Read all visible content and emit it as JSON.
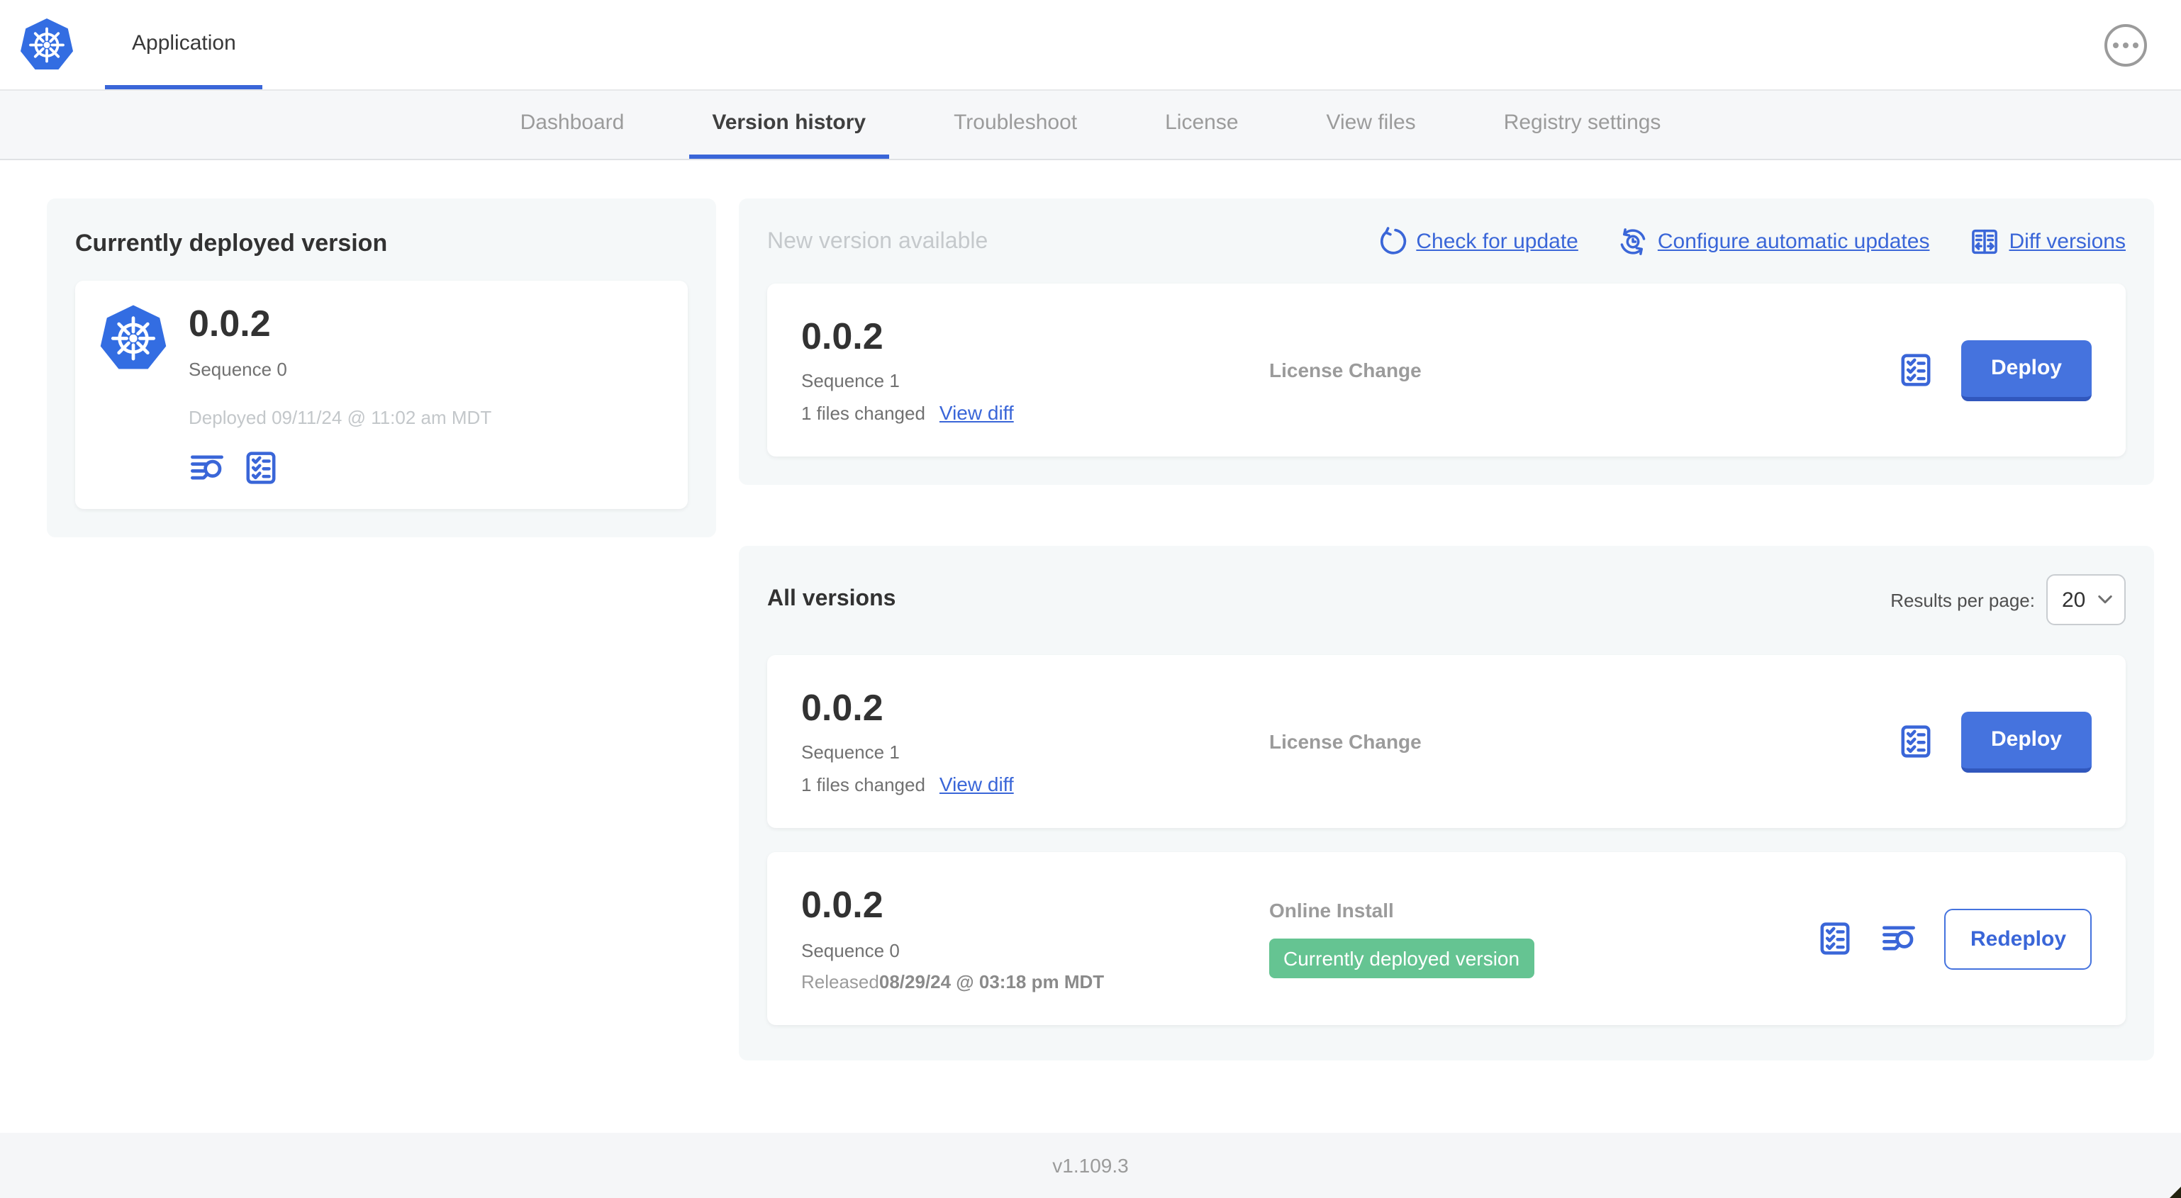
{
  "colors": {
    "accent_blue": "#3a66d8",
    "button_blue": "#4573de",
    "badge_green": "#65c492",
    "k8s_blue": "#336de2",
    "panel_bg": "#f5f8f9"
  },
  "header": {
    "app_tab_label": "Application"
  },
  "nav": {
    "tabs": [
      {
        "label": "Dashboard",
        "active": false
      },
      {
        "label": "Version history",
        "active": true
      },
      {
        "label": "Troubleshoot",
        "active": false
      },
      {
        "label": "License",
        "active": false
      },
      {
        "label": "View files",
        "active": false
      },
      {
        "label": "Registry settings",
        "active": false
      }
    ]
  },
  "current_deployed": {
    "title": "Currently deployed version",
    "version": "0.0.2",
    "sequence": "Sequence 0",
    "deployed": "Deployed 09/11/24 @ 11:02 am MDT"
  },
  "new_version": {
    "title": "New version available",
    "actions": [
      {
        "label": "Check for update",
        "icon": "refresh-icon"
      },
      {
        "label": "Configure automatic updates",
        "icon": "auto-update-icon"
      },
      {
        "label": "Diff versions",
        "icon": "diff-icon"
      }
    ],
    "card": {
      "version": "0.0.2",
      "sequence": "Sequence 1",
      "files_changed": "1 files changed",
      "view_diff_label": "View diff",
      "status": "License Change",
      "deploy_label": "Deploy"
    }
  },
  "all_versions": {
    "title": "All versions",
    "results_per_page_label": "Results per page:",
    "results_per_page_value": "20",
    "rows": [
      {
        "version": "0.0.2",
        "sequence": "Sequence 1",
        "files_changed": "1 files changed",
        "view_diff_label": "View diff",
        "status": "License Change",
        "action_label": "Deploy"
      },
      {
        "version": "0.0.2",
        "sequence": "Sequence 0",
        "released_prefix": "Released ",
        "released_date": "08/29/24 @ 03:18 pm MDT",
        "status": "Online Install",
        "badge": "Currently deployed version",
        "action_label": "Redeploy"
      }
    ]
  },
  "footer": {
    "app_version": "v1.109.3"
  }
}
